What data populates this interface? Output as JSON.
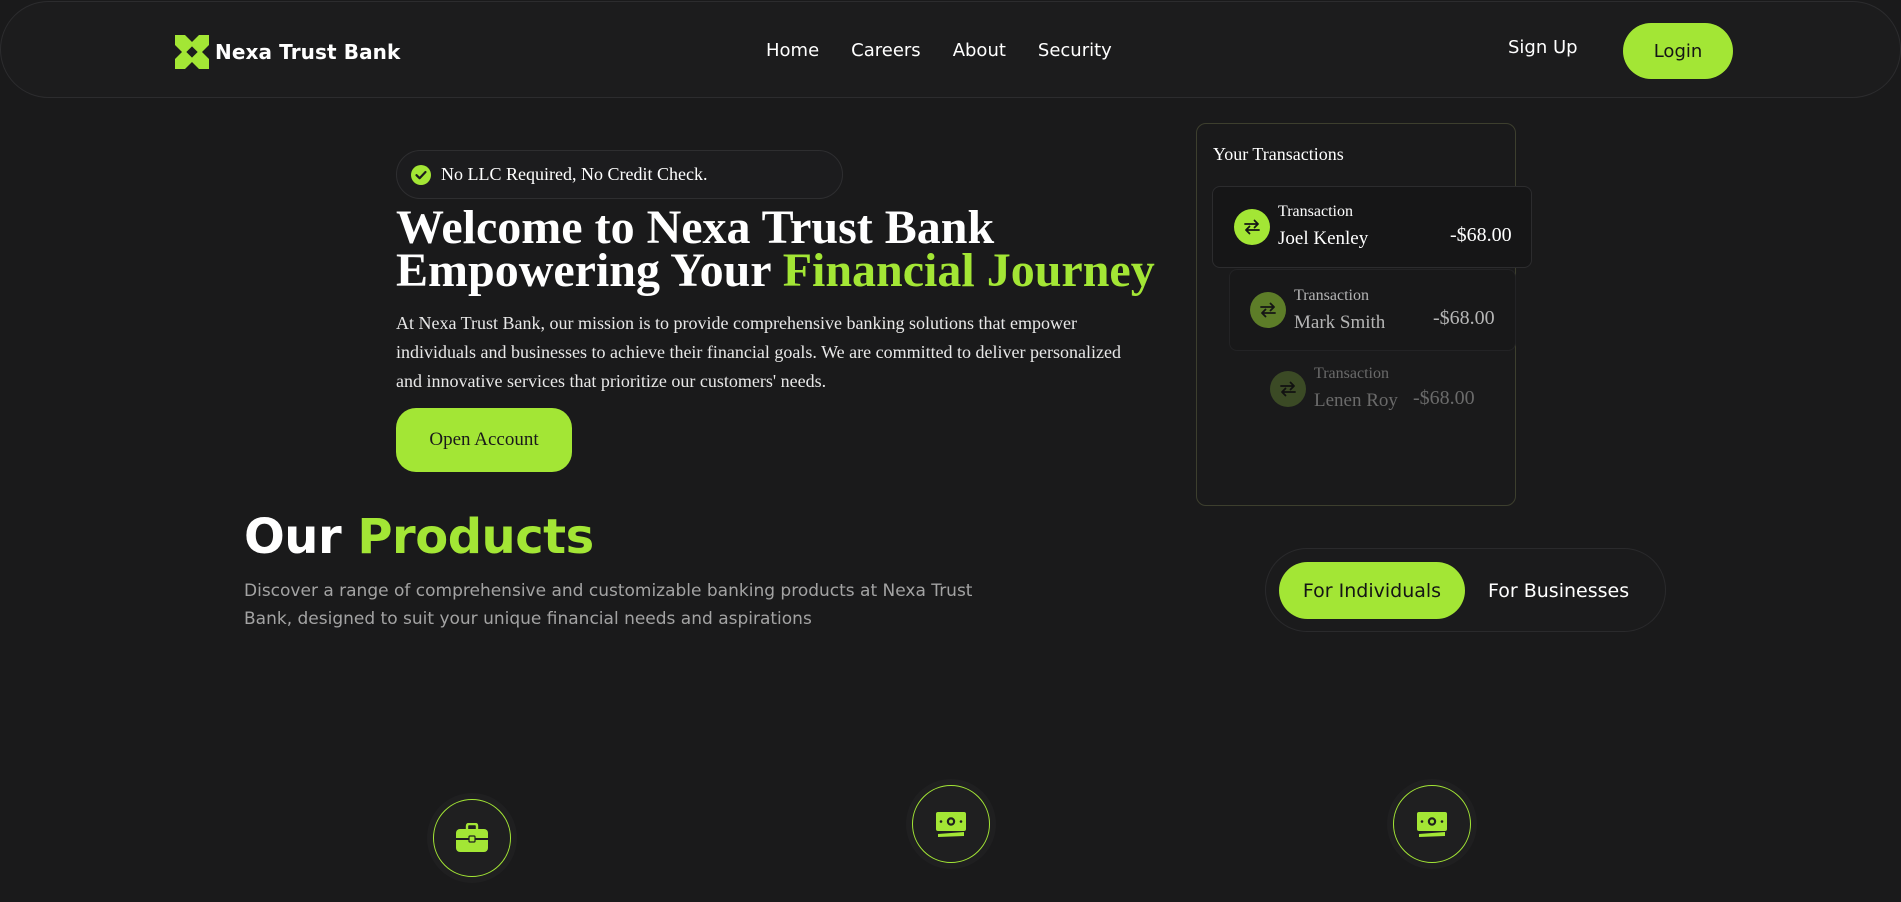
{
  "header": {
    "brand": "Nexa Trust Bank",
    "nav": [
      "Home",
      "Careers",
      "About",
      "Security"
    ],
    "signup_label": "Sign Up",
    "login_label": "Login"
  },
  "hero": {
    "badge": "No LLC Required, No Credit Check.",
    "title_line1": "Welcome to Nexa Trust Bank",
    "title_line2_prefix": "Empowering Your ",
    "title_line2_accent": "Financial Journey",
    "description": "At Nexa Trust Bank, our mission is to provide comprehensive banking solutions that empower individuals and businesses to achieve their financial goals. We are committed to deliver personalized and innovative services that prioritize our customers' needs.",
    "cta_label": "Open Account"
  },
  "transactions": {
    "title": "Your Transactions",
    "items": [
      {
        "label": "Transaction",
        "name": "Joel Kenley",
        "amount": "-$68.00"
      },
      {
        "label": "Transaction",
        "name": "Mark Smith",
        "amount": "-$68.00"
      },
      {
        "label": "Transaction",
        "name": "Lenen Roy",
        "amount": "-$68.00"
      }
    ]
  },
  "products": {
    "title_prefix": "Our ",
    "title_accent": "Products",
    "description": "Discover a range of comprehensive and customizable banking products at Nexa Trust Bank, designed to suit your unique financial needs and aspirations",
    "toggle": {
      "active": "For Individuals",
      "inactive": "For Businesses"
    },
    "feature_icons": [
      "briefcase-icon",
      "banknote-icon",
      "banknote-icon"
    ]
  },
  "colors": {
    "accent": "#a3e635",
    "background": "#1a1a1b",
    "muted_text": "#a3a3a3"
  }
}
